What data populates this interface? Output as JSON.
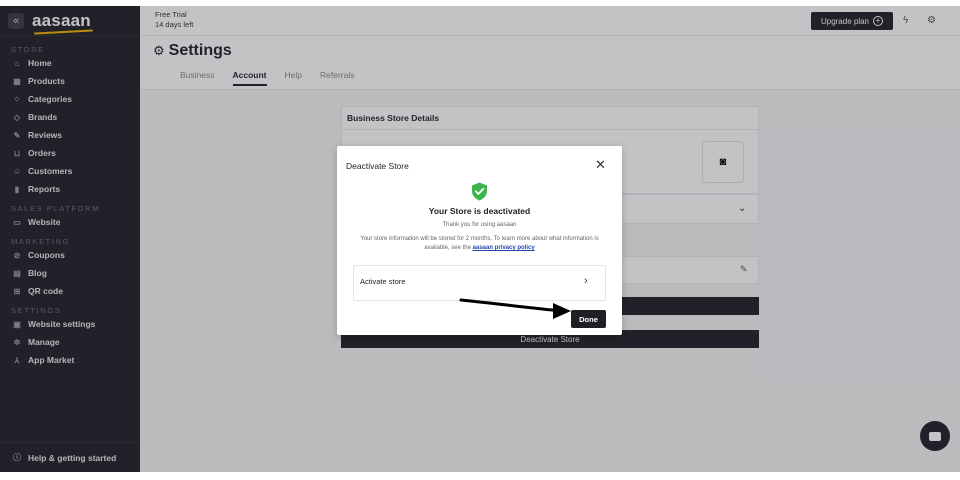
{
  "sidebar": {
    "logo": "aasaan",
    "collapse_glyph": "«",
    "sections": {
      "store": "STORE",
      "sales_platform": "SALES PLATFORM",
      "marketing": "MARKETING",
      "settings": "SETTINGS"
    },
    "items": {
      "home": "Home",
      "products": "Products",
      "categories": "Categories",
      "brands": "Brands",
      "reviews": "Reviews",
      "orders": "Orders",
      "customers": "Customers",
      "reports": "Reports",
      "website": "Website",
      "coupons": "Coupons",
      "blog": "Blog",
      "qr_code": "QR code",
      "website_settings": "Website settings",
      "manage": "Manage",
      "app_market": "App Market"
    },
    "help": "Help & getting started"
  },
  "topbar": {
    "trial_line1": "Free Trial",
    "trial_line2": "14 days left",
    "upgrade_label": "Upgrade plan"
  },
  "header": {
    "title": "Settings",
    "tabs": {
      "business": "Business",
      "account": "Account",
      "help": "Help",
      "referrals": "Referrals"
    },
    "active_tab": "Account"
  },
  "content": {
    "store_details_title": "Business Store Details",
    "deactivate_label": "Deactivate Store"
  },
  "modal": {
    "title": "Deactivate Store",
    "heading": "Your Store is deactivated",
    "thanks": "Thank you for using aasaan",
    "info_text": "Your store information will be stored for 2 months. To learn more about what information is available, see the",
    "policy_link": "aasaan privacy policy",
    "activate_label": "Activate store",
    "done_label": "Done"
  },
  "colors": {
    "sidebar_bg": "#1f2027",
    "accent": "#f5b400",
    "success": "#3cb44b",
    "link": "#2446a8"
  }
}
